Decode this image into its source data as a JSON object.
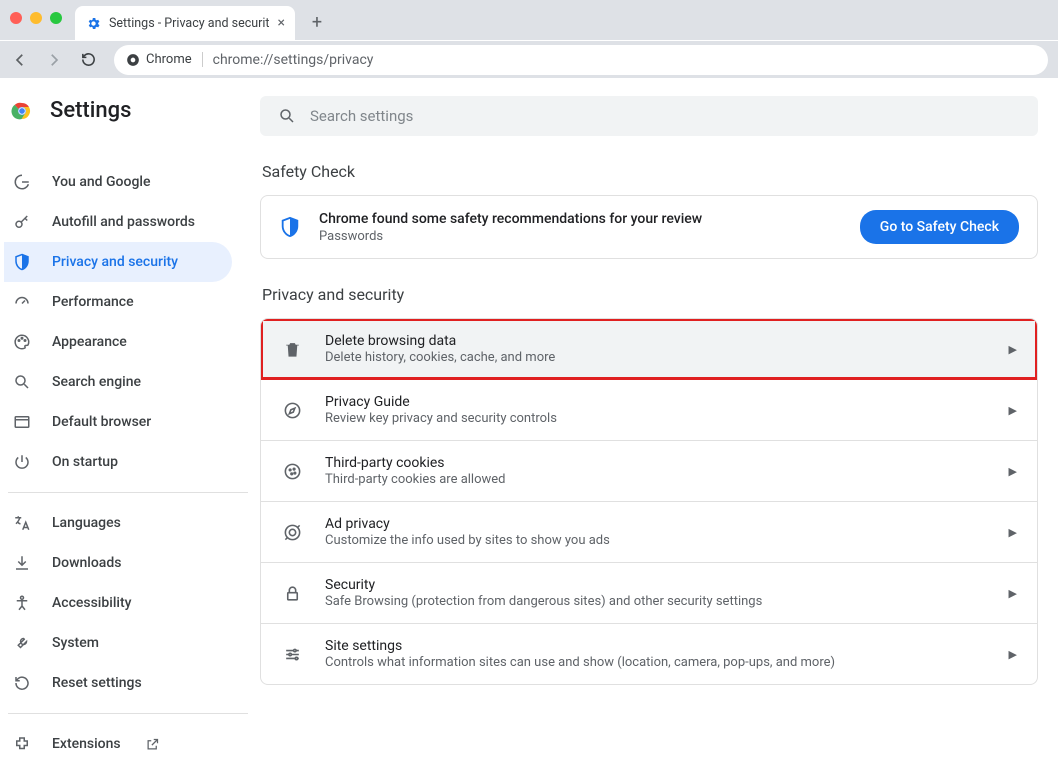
{
  "tab": {
    "title": "Settings - Privacy and securit"
  },
  "omnibox": {
    "chip": "Chrome",
    "url": "chrome://settings/privacy"
  },
  "app": {
    "title": "Settings"
  },
  "search": {
    "placeholder": "Search settings"
  },
  "sidebar": {
    "items": [
      {
        "label": "You and Google"
      },
      {
        "label": "Autofill and passwords"
      },
      {
        "label": "Privacy and security"
      },
      {
        "label": "Performance"
      },
      {
        "label": "Appearance"
      },
      {
        "label": "Search engine"
      },
      {
        "label": "Default browser"
      },
      {
        "label": "On startup"
      }
    ],
    "more": [
      {
        "label": "Languages"
      },
      {
        "label": "Downloads"
      },
      {
        "label": "Accessibility"
      },
      {
        "label": "System"
      },
      {
        "label": "Reset settings"
      }
    ],
    "ext": {
      "label": "Extensions"
    }
  },
  "sections": {
    "safety": {
      "heading": "Safety Check",
      "title": "Chrome found some safety recommendations for your review",
      "sub": "Passwords",
      "button": "Go to Safety Check"
    },
    "privacy": {
      "heading": "Privacy and security",
      "rows": [
        {
          "title": "Delete browsing data",
          "sub": "Delete history, cookies, cache, and more"
        },
        {
          "title": "Privacy Guide",
          "sub": "Review key privacy and security controls"
        },
        {
          "title": "Third-party cookies",
          "sub": "Third-party cookies are allowed"
        },
        {
          "title": "Ad privacy",
          "sub": "Customize the info used by sites to show you ads"
        },
        {
          "title": "Security",
          "sub": "Safe Browsing (protection from dangerous sites) and other security settings"
        },
        {
          "title": "Site settings",
          "sub": "Controls what information sites can use and show (location, camera, pop-ups, and more)"
        }
      ]
    }
  }
}
